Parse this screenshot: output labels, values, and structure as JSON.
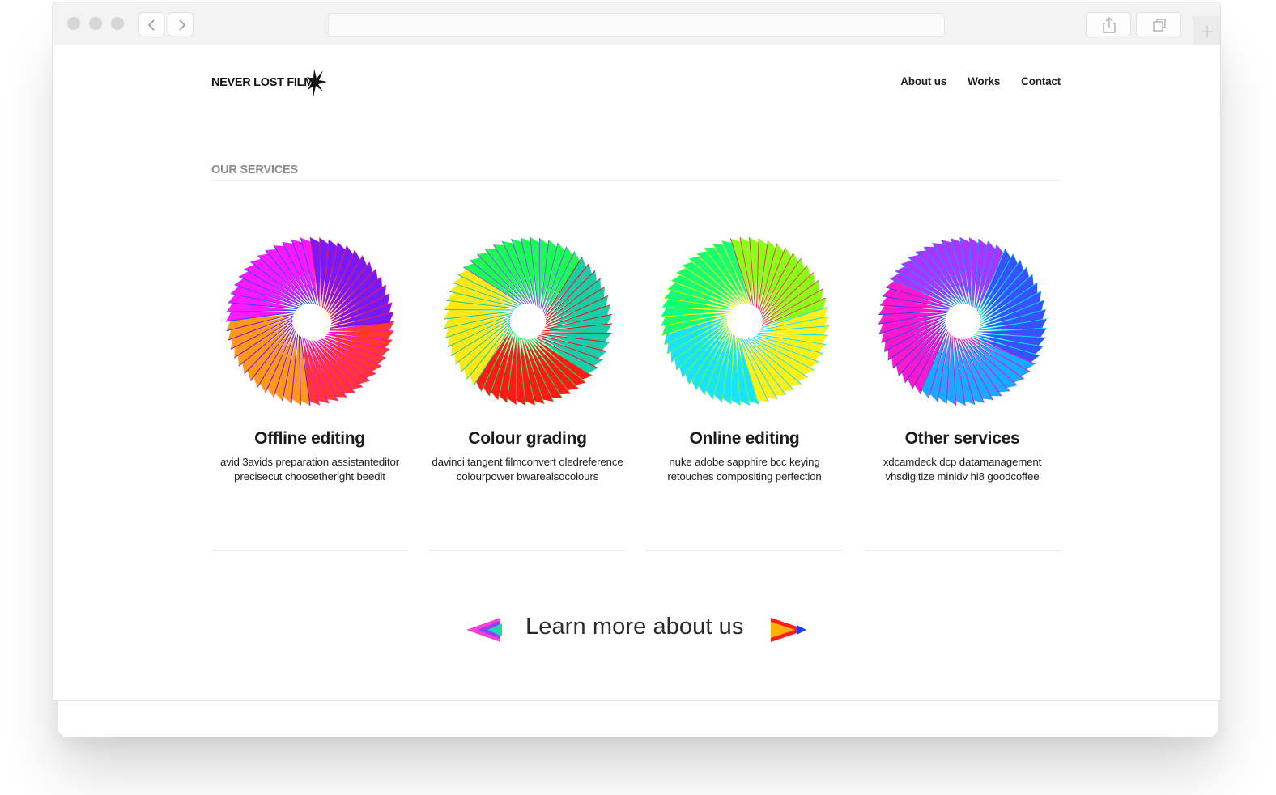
{
  "browser": {
    "back_icon": "chevron-left-icon",
    "forward_icon": "chevron-right-icon",
    "share_icon": "share-icon",
    "tabs_icon": "tabs-icon",
    "new_tab_icon": "plus-icon"
  },
  "header": {
    "logo_text": "NEVER LOST FILM",
    "nav": [
      "About us",
      "Works",
      "Contact"
    ]
  },
  "services_section": {
    "title": "OUR SERVICES",
    "items": [
      {
        "title": "Offline editing",
        "line1": "avid 3avids preparation assistanteditor",
        "line2": "precisecut choosetheright beedit",
        "palette": [
          "#ff2020",
          "#ff8c00",
          "#ff00ff",
          "#6a00ff",
          "#1a4cff"
        ]
      },
      {
        "title": "Colour grading",
        "line1": "davinci tangent filmconvert oledreference",
        "line2": "colourpower bwarealsocolours",
        "palette": [
          "#ff0000",
          "#ffe600",
          "#00ff40",
          "#00c8a0",
          "#8844ff"
        ]
      },
      {
        "title": "Online editing",
        "line1": "nuke adobe sapphire bcc keying",
        "line2": "retouches compositing perfection",
        "palette": [
          "#00e0ff",
          "#00ff66",
          "#7dff00",
          "#ffee00",
          "#ff2050"
        ]
      },
      {
        "title": "Other services",
        "line1": "xdcamdeck dcp datamanagement",
        "line2": "vhsdigitize minidv hi8 goodcoffee",
        "palette": [
          "#ff00c8",
          "#a020ff",
          "#2040ff",
          "#00a0ff",
          "#00f0e0"
        ]
      }
    ]
  },
  "cta": {
    "label": "Learn more about us",
    "left_arrow_icon": "arrow-left-icon",
    "right_arrow_icon": "arrow-right-icon"
  }
}
